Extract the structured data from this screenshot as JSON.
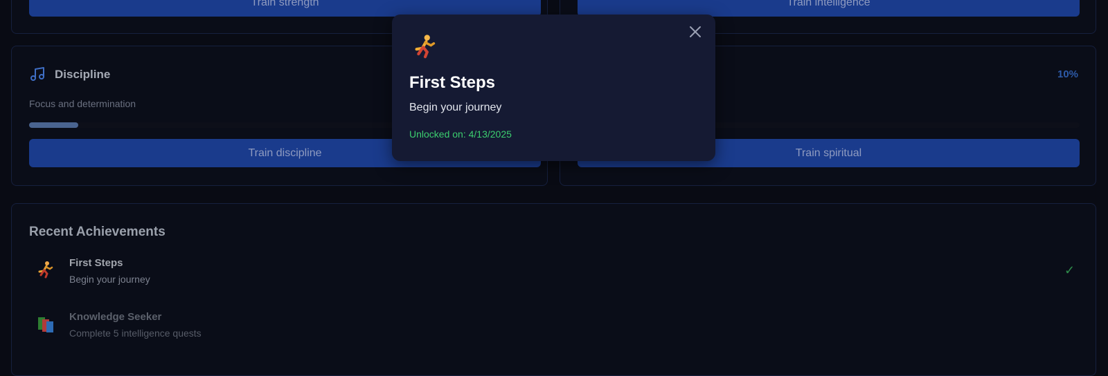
{
  "top_cards": {
    "strength_button": "Train strength",
    "intelligence_button": "Train intelligence"
  },
  "discipline_card": {
    "icon": "music-note-icon",
    "title": "Discipline",
    "description": "Focus and determination",
    "progress": 0.1,
    "button": "Train discipline"
  },
  "spiritual_card": {
    "percent_label": "10%",
    "progress": 0.1,
    "button": "Train spiritual"
  },
  "achievements": {
    "heading": "Recent Achievements",
    "items": [
      {
        "icon": "running-person-icon",
        "title": "First Steps",
        "description": "Begin your journey",
        "unlocked": true
      },
      {
        "icon": "books-icon",
        "title": "Knowledge Seeker",
        "description": "Complete 5 intelligence quests",
        "unlocked": false
      }
    ],
    "check_color": "#2f8c4b"
  },
  "modal": {
    "icon": "running-person-icon",
    "title": "First Steps",
    "description": "Begin your journey",
    "unlocked_text": "Unlocked on: 4/13/2025",
    "accent": "#3ccf6f"
  },
  "colors": {
    "background": "#090b14",
    "button": "#1a3b8c",
    "card_border": "#16203f"
  }
}
